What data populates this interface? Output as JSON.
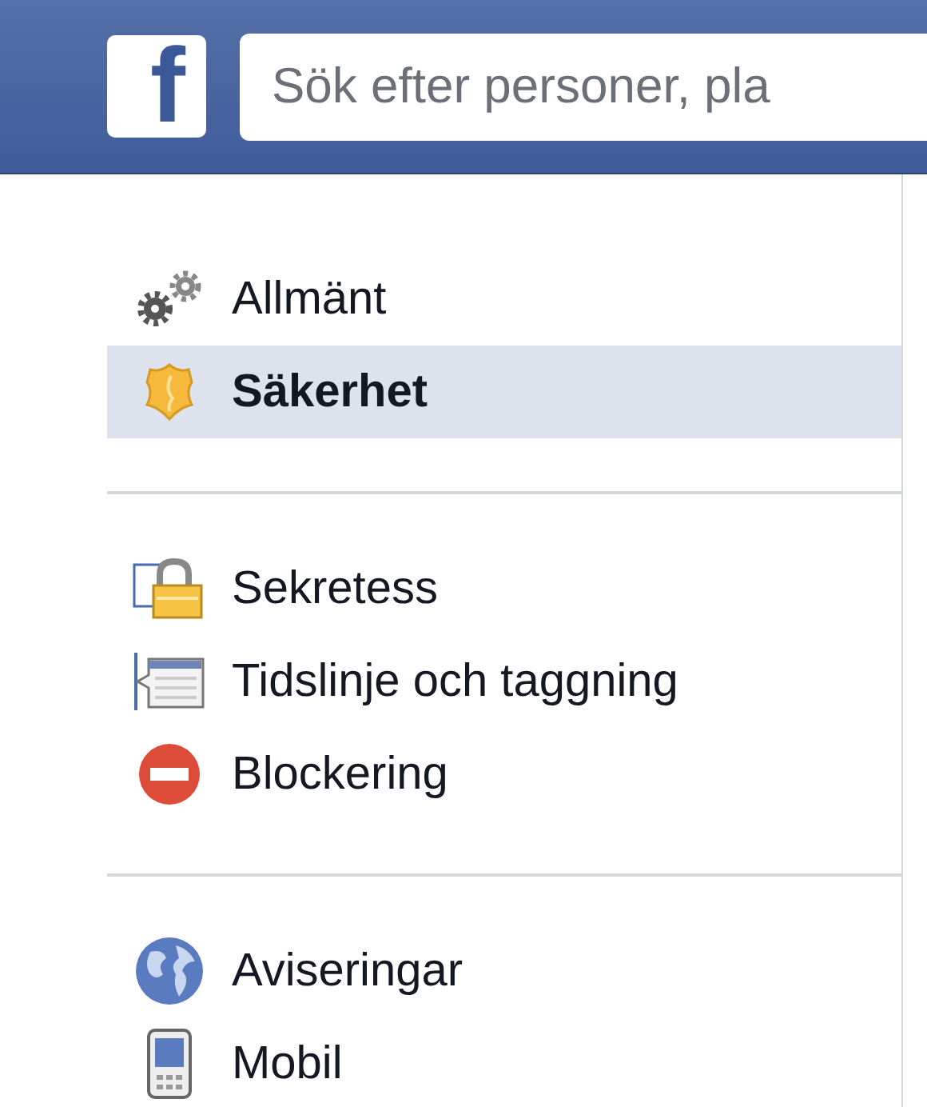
{
  "header": {
    "logo": "f",
    "search": {
      "placeholder": "Sök efter personer, pla"
    }
  },
  "menu": {
    "sections": [
      [
        {
          "kind": "gears",
          "label": "Allmänt",
          "selected": false
        },
        {
          "kind": "shield",
          "label": "Säkerhet",
          "selected": true
        }
      ],
      [
        {
          "kind": "lock",
          "label": "Sekretess",
          "selected": false
        },
        {
          "kind": "timeline",
          "label": "Tidslinje och taggning",
          "selected": false
        },
        {
          "kind": "block",
          "label": "Blockering",
          "selected": false
        }
      ],
      [
        {
          "kind": "globe",
          "label": "Aviseringar",
          "selected": false
        },
        {
          "kind": "phone",
          "label": "Mobil",
          "selected": false
        }
      ]
    ]
  }
}
